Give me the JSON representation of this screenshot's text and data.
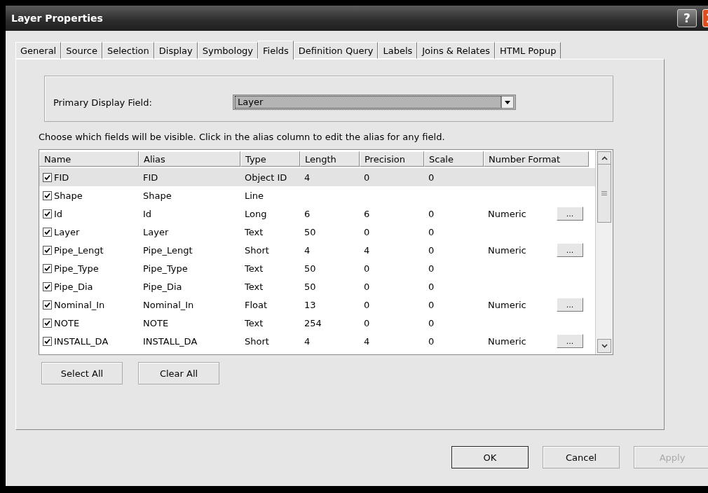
{
  "window": {
    "title": "Layer Properties",
    "help": "?"
  },
  "tabs": [
    {
      "label": "General",
      "selected": false
    },
    {
      "label": "Source",
      "selected": false
    },
    {
      "label": "Selection",
      "selected": false
    },
    {
      "label": "Display",
      "selected": false
    },
    {
      "label": "Symbology",
      "selected": false
    },
    {
      "label": "Fields",
      "selected": true
    },
    {
      "label": "Definition Query",
      "selected": false
    },
    {
      "label": "Labels",
      "selected": false
    },
    {
      "label": "Joins & Relates",
      "selected": false
    },
    {
      "label": "HTML Popup",
      "selected": false
    }
  ],
  "primary_display_field": {
    "label": "Primary Display Field:",
    "value": "Layer"
  },
  "instructions": "Choose which fields will be visible. Click in the alias column to edit the alias for any field.",
  "table": {
    "columns": [
      "Name",
      "Alias",
      "Type",
      "Length",
      "Precision",
      "Scale",
      "Number Format"
    ],
    "rows": [
      {
        "checked": true,
        "selected": true,
        "cells": [
          "FID",
          "FID",
          "Object ID",
          "4",
          "0",
          "0",
          ""
        ],
        "format_button": null
      },
      {
        "checked": true,
        "selected": false,
        "cells": [
          "Shape",
          "Shape",
          "Line",
          "",
          "",
          "",
          ""
        ],
        "format_button": null
      },
      {
        "checked": true,
        "selected": false,
        "cells": [
          "Id",
          "Id",
          "Long",
          "6",
          "6",
          "0",
          "Numeric"
        ],
        "format_button": "..."
      },
      {
        "checked": true,
        "selected": false,
        "cells": [
          "Layer",
          "Layer",
          "Text",
          "50",
          "0",
          "0",
          ""
        ],
        "format_button": null
      },
      {
        "checked": true,
        "selected": false,
        "cells": [
          "Pipe_Lengt",
          "Pipe_Lengt",
          "Short",
          "4",
          "4",
          "0",
          "Numeric"
        ],
        "format_button": "..."
      },
      {
        "checked": true,
        "selected": false,
        "cells": [
          "Pipe_Type",
          "Pipe_Type",
          "Text",
          "50",
          "0",
          "0",
          ""
        ],
        "format_button": null
      },
      {
        "checked": true,
        "selected": false,
        "cells": [
          "Pipe_Dia",
          "Pipe_Dia",
          "Text",
          "50",
          "0",
          "0",
          ""
        ],
        "format_button": null
      },
      {
        "checked": true,
        "selected": false,
        "cells": [
          "Nominal_In",
          "Nominal_In",
          "Float",
          "13",
          "0",
          "0",
          "Numeric"
        ],
        "format_button": "..."
      },
      {
        "checked": true,
        "selected": false,
        "cells": [
          "NOTE",
          "NOTE",
          "Text",
          "254",
          "0",
          "0",
          ""
        ],
        "format_button": null
      },
      {
        "checked": true,
        "selected": false,
        "cells": [
          "INSTALL_DA",
          "INSTALL_DA",
          "Short",
          "4",
          "4",
          "0",
          "Numeric"
        ],
        "format_button": "..."
      }
    ]
  },
  "table_buttons": [
    "Select All",
    "Clear All"
  ],
  "dialog_buttons": [
    {
      "label": "OK",
      "disabled": false
    },
    {
      "label": "Cancel",
      "disabled": false
    },
    {
      "label": "Apply",
      "disabled": true
    }
  ]
}
